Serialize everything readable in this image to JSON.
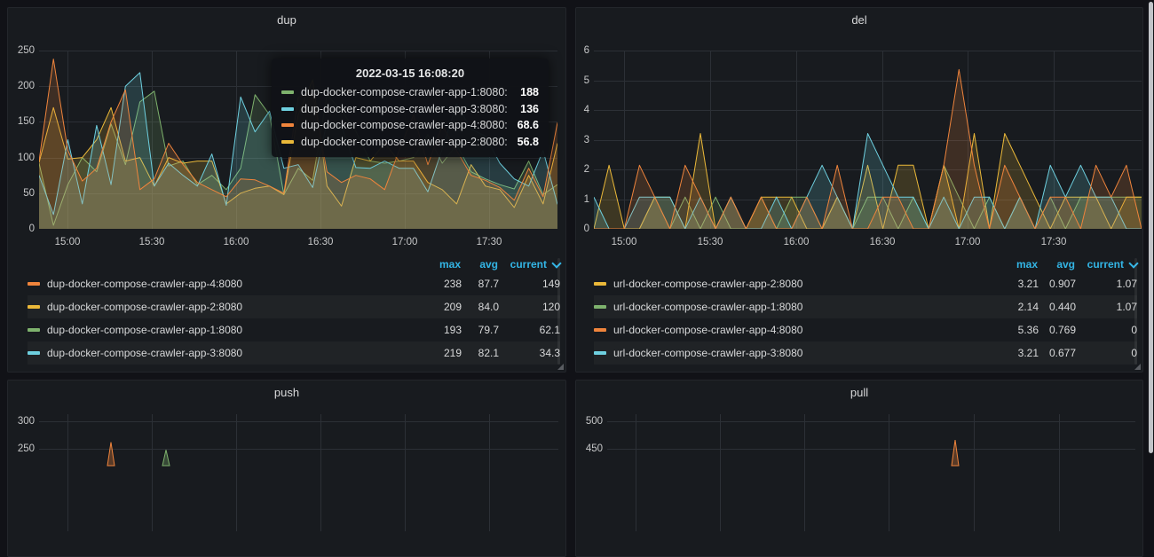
{
  "palette": {
    "green": "#7EB26D",
    "yellow": "#EAB839",
    "cyan": "#6ED0E0",
    "orange": "#EF843C",
    "header_blue": "#33b5e5"
  },
  "panels": {
    "dup": {
      "title": "dup",
      "legend": {
        "headers": {
          "max": "max",
          "avg": "avg",
          "current": "current"
        },
        "sorted_by": "current",
        "rows": [
          {
            "name": "dup-docker-compose-crawler-app-4:8080",
            "color": "orange",
            "max": "238",
            "avg": "87.7",
            "current": "149"
          },
          {
            "name": "dup-docker-compose-crawler-app-2:8080",
            "color": "yellow",
            "max": "209",
            "avg": "84.0",
            "current": "120"
          },
          {
            "name": "dup-docker-compose-crawler-app-1:8080",
            "color": "green",
            "max": "193",
            "avg": "79.7",
            "current": "62.1"
          },
          {
            "name": "dup-docker-compose-crawler-app-3:8080",
            "color": "cyan",
            "max": "219",
            "avg": "82.1",
            "current": "34.3"
          }
        ]
      }
    },
    "del": {
      "title": "del",
      "legend": {
        "headers": {
          "max": "max",
          "avg": "avg",
          "current": "current"
        },
        "sorted_by": "current",
        "rows": [
          {
            "name": "url-docker-compose-crawler-app-2:8080",
            "color": "yellow",
            "max": "3.21",
            "avg": "0.907",
            "current": "1.07"
          },
          {
            "name": "url-docker-compose-crawler-app-1:8080",
            "color": "green",
            "max": "2.14",
            "avg": "0.440",
            "current": "1.07"
          },
          {
            "name": "url-docker-compose-crawler-app-4:8080",
            "color": "orange",
            "max": "5.36",
            "avg": "0.769",
            "current": "0"
          },
          {
            "name": "url-docker-compose-crawler-app-3:8080",
            "color": "cyan",
            "max": "3.21",
            "avg": "0.677",
            "current": "0"
          }
        ]
      }
    },
    "push": {
      "title": "push"
    },
    "pull": {
      "title": "pull"
    }
  },
  "tooltip": {
    "time": "2022-03-15 16:08:20",
    "rows": [
      {
        "label": "dup-docker-compose-crawler-app-1:8080:",
        "color": "green",
        "value": "188"
      },
      {
        "label": "dup-docker-compose-crawler-app-3:8080:",
        "color": "cyan",
        "value": "136"
      },
      {
        "label": "dup-docker-compose-crawler-app-4:8080:",
        "color": "orange",
        "value": "68.6"
      },
      {
        "label": "dup-docker-compose-crawler-app-2:8080:",
        "color": "yellow",
        "value": "56.8"
      }
    ]
  },
  "chart_data": [
    {
      "id": "dup",
      "type": "line",
      "title": "dup",
      "grid": true,
      "legend_position": "bottom-table",
      "x_range": [
        "14:50",
        "17:53"
      ],
      "x_ticks": [
        "15:00",
        "15:30",
        "16:00",
        "16:30",
        "17:00",
        "17:30"
      ],
      "ylim": [
        0,
        250
      ],
      "y_ticks": [
        0,
        50,
        100,
        150,
        200,
        250
      ],
      "series": [
        {
          "name": "dup-docker-compose-crawler-app-1:8080",
          "color": "green",
          "values": [
            92,
            5,
            62,
            100,
            80,
            147,
            90,
            178,
            193,
            88,
            95,
            62,
            75,
            55,
            85,
            188,
            160,
            48,
            85,
            68,
            188,
            166,
            137,
            95,
            92,
            95,
            100,
            132,
            92,
            118,
            80,
            70,
            62,
            56,
            95,
            48,
            62.1
          ]
        },
        {
          "name": "dup-docker-compose-crawler-app-2:8080",
          "color": "yellow",
          "values": [
            93,
            170,
            98,
            100,
            125,
            170,
            95,
            100,
            60,
            100,
            92,
            95,
            95,
            35,
            50,
            56.8,
            60,
            48,
            160,
            209,
            60,
            32,
            100,
            95,
            120,
            95,
            95,
            65,
            55,
            35,
            90,
            60,
            55,
            30,
            75,
            35,
            120
          ]
        },
        {
          "name": "dup-docker-compose-crawler-app-3:8080",
          "color": "cyan",
          "values": [
            75,
            20,
            125,
            35,
            145,
            62,
            200,
            219,
            60,
            92,
            75,
            60,
            105,
            33,
            185,
            136,
            165,
            85,
            90,
            58,
            150,
            144,
            86,
            85,
            95,
            85,
            85,
            52,
            112,
            175,
            140,
            130,
            92,
            70,
            60,
            110,
            34.3
          ]
        },
        {
          "name": "dup-docker-compose-crawler-app-4:8080",
          "color": "orange",
          "values": [
            95,
            238,
            110,
            67,
            85,
            150,
            195,
            55,
            70,
            120,
            90,
            65,
            55,
            45,
            70,
            68.6,
            60,
            50,
            185,
            190,
            80,
            65,
            75,
            70,
            55,
            110,
            160,
            90,
            145,
            110,
            75,
            68,
            58,
            40,
            85,
            45,
            149
          ]
        }
      ]
    },
    {
      "id": "del",
      "type": "line",
      "title": "del",
      "grid": true,
      "legend_position": "bottom-table",
      "x_range": [
        "14:50",
        "17:53"
      ],
      "x_ticks": [
        "15:00",
        "15:30",
        "16:00",
        "16:30",
        "17:00",
        "17:30"
      ],
      "ylim": [
        0,
        6
      ],
      "y_ticks": [
        0,
        1,
        2,
        3,
        4,
        5,
        6
      ],
      "series": [
        {
          "name": "url-docker-compose-crawler-app-1:8080",
          "color": "green",
          "values": [
            0,
            0,
            0,
            0,
            1.07,
            0,
            1.07,
            0,
            1.07,
            0,
            0,
            1.07,
            0,
            1.07,
            1.07,
            0,
            1.07,
            0,
            1.07,
            1.07,
            0,
            1.07,
            0,
            2.14,
            1.07,
            0,
            1.07,
            0,
            1.07,
            0,
            1.07,
            0,
            1.07,
            1.07,
            1.07,
            1.07,
            1.07
          ]
        },
        {
          "name": "url-docker-compose-crawler-app-2:8080",
          "color": "yellow",
          "values": [
            0,
            2.14,
            0,
            0,
            1.07,
            1.07,
            0,
            3.21,
            0,
            1.07,
            0,
            1.07,
            1.07,
            1.07,
            0,
            0,
            1.07,
            0,
            2.14,
            0,
            2.14,
            2.14,
            0,
            2.14,
            0,
            3.21,
            0,
            3.21,
            2.14,
            1.07,
            0,
            1.07,
            1.07,
            1.07,
            0,
            1.07,
            1.07
          ]
        },
        {
          "name": "url-docker-compose-crawler-app-3:8080",
          "color": "cyan",
          "values": [
            1.07,
            0,
            0,
            1.07,
            1.07,
            1.07,
            0,
            1.07,
            0,
            1.07,
            0,
            0,
            1.07,
            0,
            1.07,
            2.14,
            1.07,
            0,
            3.21,
            2.14,
            1.07,
            1.07,
            0,
            1.07,
            0,
            1.07,
            1.07,
            0,
            1.07,
            0,
            2.14,
            1.07,
            2.14,
            1.07,
            1.07,
            0,
            0
          ]
        },
        {
          "name": "url-docker-compose-crawler-app-4:8080",
          "color": "orange",
          "values": [
            0,
            0,
            0,
            2.14,
            1.07,
            0,
            2.14,
            1.07,
            0,
            1.07,
            0,
            1.07,
            0,
            0,
            1.07,
            0,
            2.14,
            0,
            0,
            1.07,
            1.07,
            0,
            0,
            2.14,
            5.36,
            2.14,
            0,
            2.14,
            1.07,
            0,
            1.07,
            1.07,
            0,
            2.14,
            1.07,
            2.14,
            0
          ]
        }
      ]
    },
    {
      "id": "push",
      "type": "line",
      "title": "push",
      "grid": true,
      "clipped": true,
      "visible_y_ticks": [
        300,
        250
      ],
      "visible_spikes": [
        {
          "color": "orange",
          "approx_value": 262
        },
        {
          "color": "green",
          "approx_value": 248
        }
      ]
    },
    {
      "id": "pull",
      "type": "line",
      "title": "pull",
      "grid": true,
      "clipped": true,
      "visible_y_ticks": [
        500,
        450
      ],
      "visible_spikes": [
        {
          "color": "orange",
          "approx_value": 466
        }
      ]
    }
  ]
}
